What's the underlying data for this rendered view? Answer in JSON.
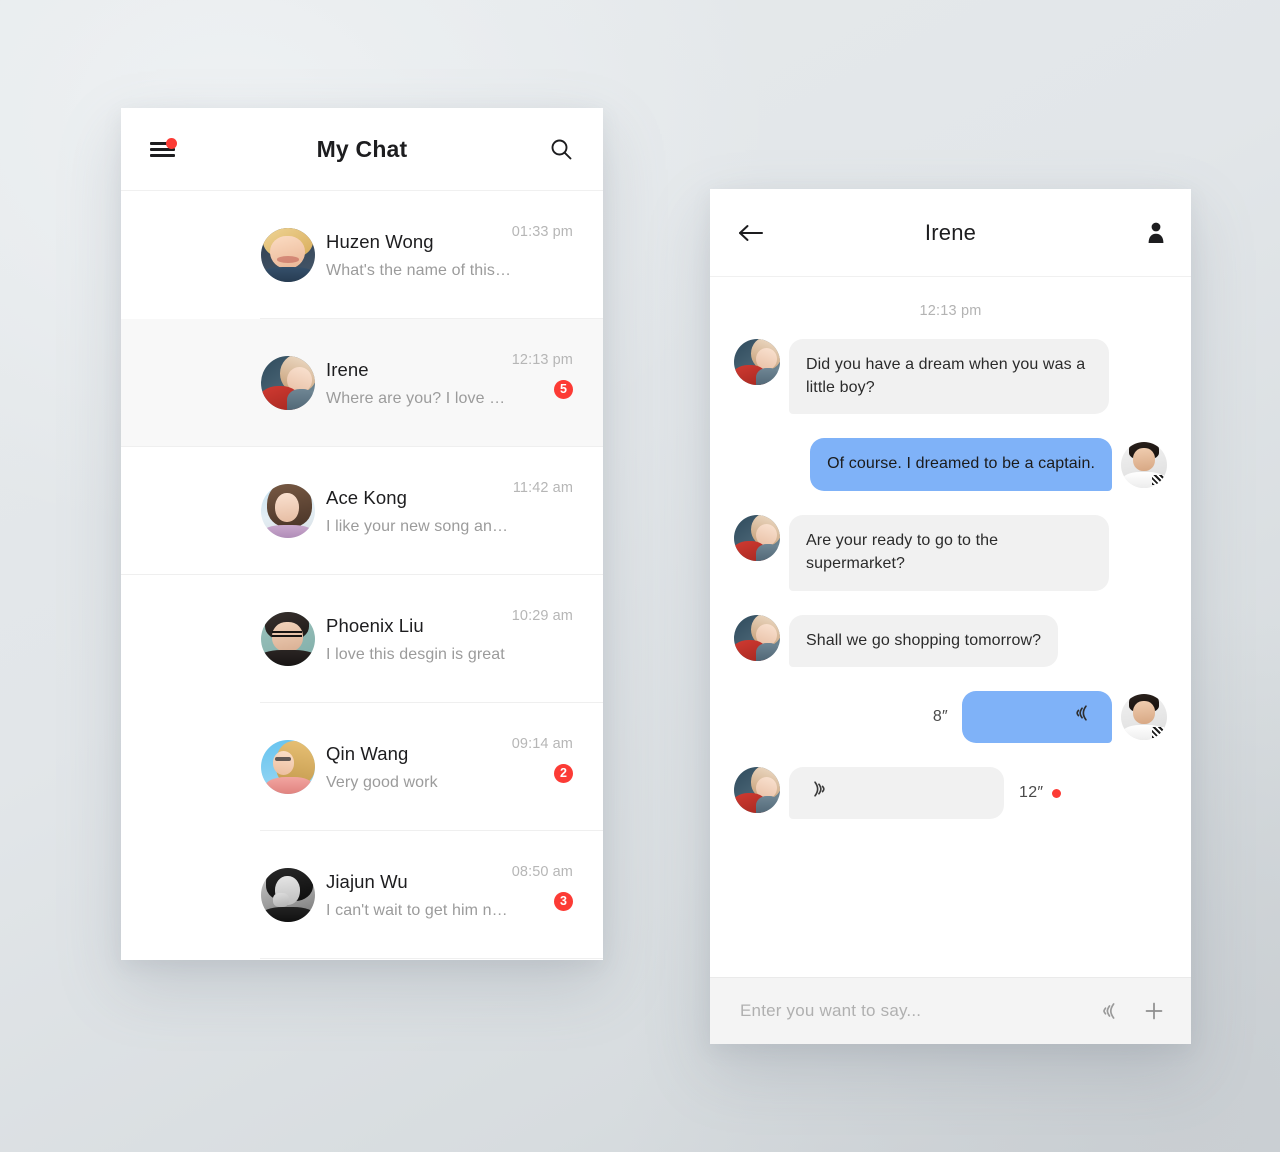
{
  "colors": {
    "accent_red": "#fc3b35",
    "bubble_out_blue": "#7fb2f8",
    "bubble_in_gray": "#f1f1f1",
    "panel_white": "#ffffff",
    "active_row": "#f8f8f8"
  },
  "list_panel": {
    "header": {
      "title": "My Chat",
      "menu_icon": "hamburger-menu-icon",
      "menu_badge": true,
      "search_icon": "search-icon"
    },
    "rows": [
      {
        "name": "Huzen Wong",
        "preview": "What's the name of this new song...",
        "time": "01:33 pm",
        "badge": "",
        "avatar": "av-huzen",
        "active": false
      },
      {
        "name": "Irene",
        "preview": "Where are you? I love you.",
        "time": "12:13 pm",
        "badge": "5",
        "avatar": "av-irene",
        "active": true
      },
      {
        "name": "Ace Kong",
        "preview": "I like your new song and download it...",
        "time": "11:42 am",
        "badge": "",
        "avatar": "av-ace",
        "active": false
      },
      {
        "name": "Phoenix Liu",
        "preview": "I love this desgin is great",
        "time": "10:29 am",
        "badge": "",
        "avatar": "av-phoenix",
        "active": false
      },
      {
        "name": "Qin Wang",
        "preview": "Very good work",
        "time": "09:14 am",
        "badge": "2",
        "avatar": "av-qin",
        "active": false
      },
      {
        "name": "Jiajun Wu",
        "preview": "I can't wait to get him now",
        "time": "08:50 am",
        "badge": "3",
        "avatar": "av-jiajun",
        "active": false
      }
    ]
  },
  "chat_panel": {
    "header": {
      "back_icon": "back-arrow-icon",
      "title": "Irene",
      "contact_icon": "contact-person-icon"
    },
    "timestamp": "12:13 pm",
    "messages": [
      {
        "side": "in",
        "type": "text",
        "text": "Did you have a dream when you was a little boy?",
        "avatar": "av-irene"
      },
      {
        "side": "out",
        "type": "text",
        "text": "Of course. I dreamed to be a captain.",
        "avatar": "av-me"
      },
      {
        "side": "in",
        "type": "text",
        "text": "Are your ready to go to the supermarket?",
        "avatar": "av-irene"
      },
      {
        "side": "in",
        "type": "text",
        "text": "Shall we go shopping tomorrow?",
        "avatar": "av-irene"
      },
      {
        "side": "out",
        "type": "voice",
        "duration": "8″",
        "unread": false,
        "avatar": "av-me"
      },
      {
        "side": "in",
        "type": "voice",
        "duration": "12″",
        "unread": true,
        "avatar": "av-irene"
      }
    ],
    "input": {
      "value": "",
      "placeholder": "Enter you want to say...",
      "mic_icon": "voice-wave-icon",
      "plus_icon": "plus-icon"
    }
  }
}
